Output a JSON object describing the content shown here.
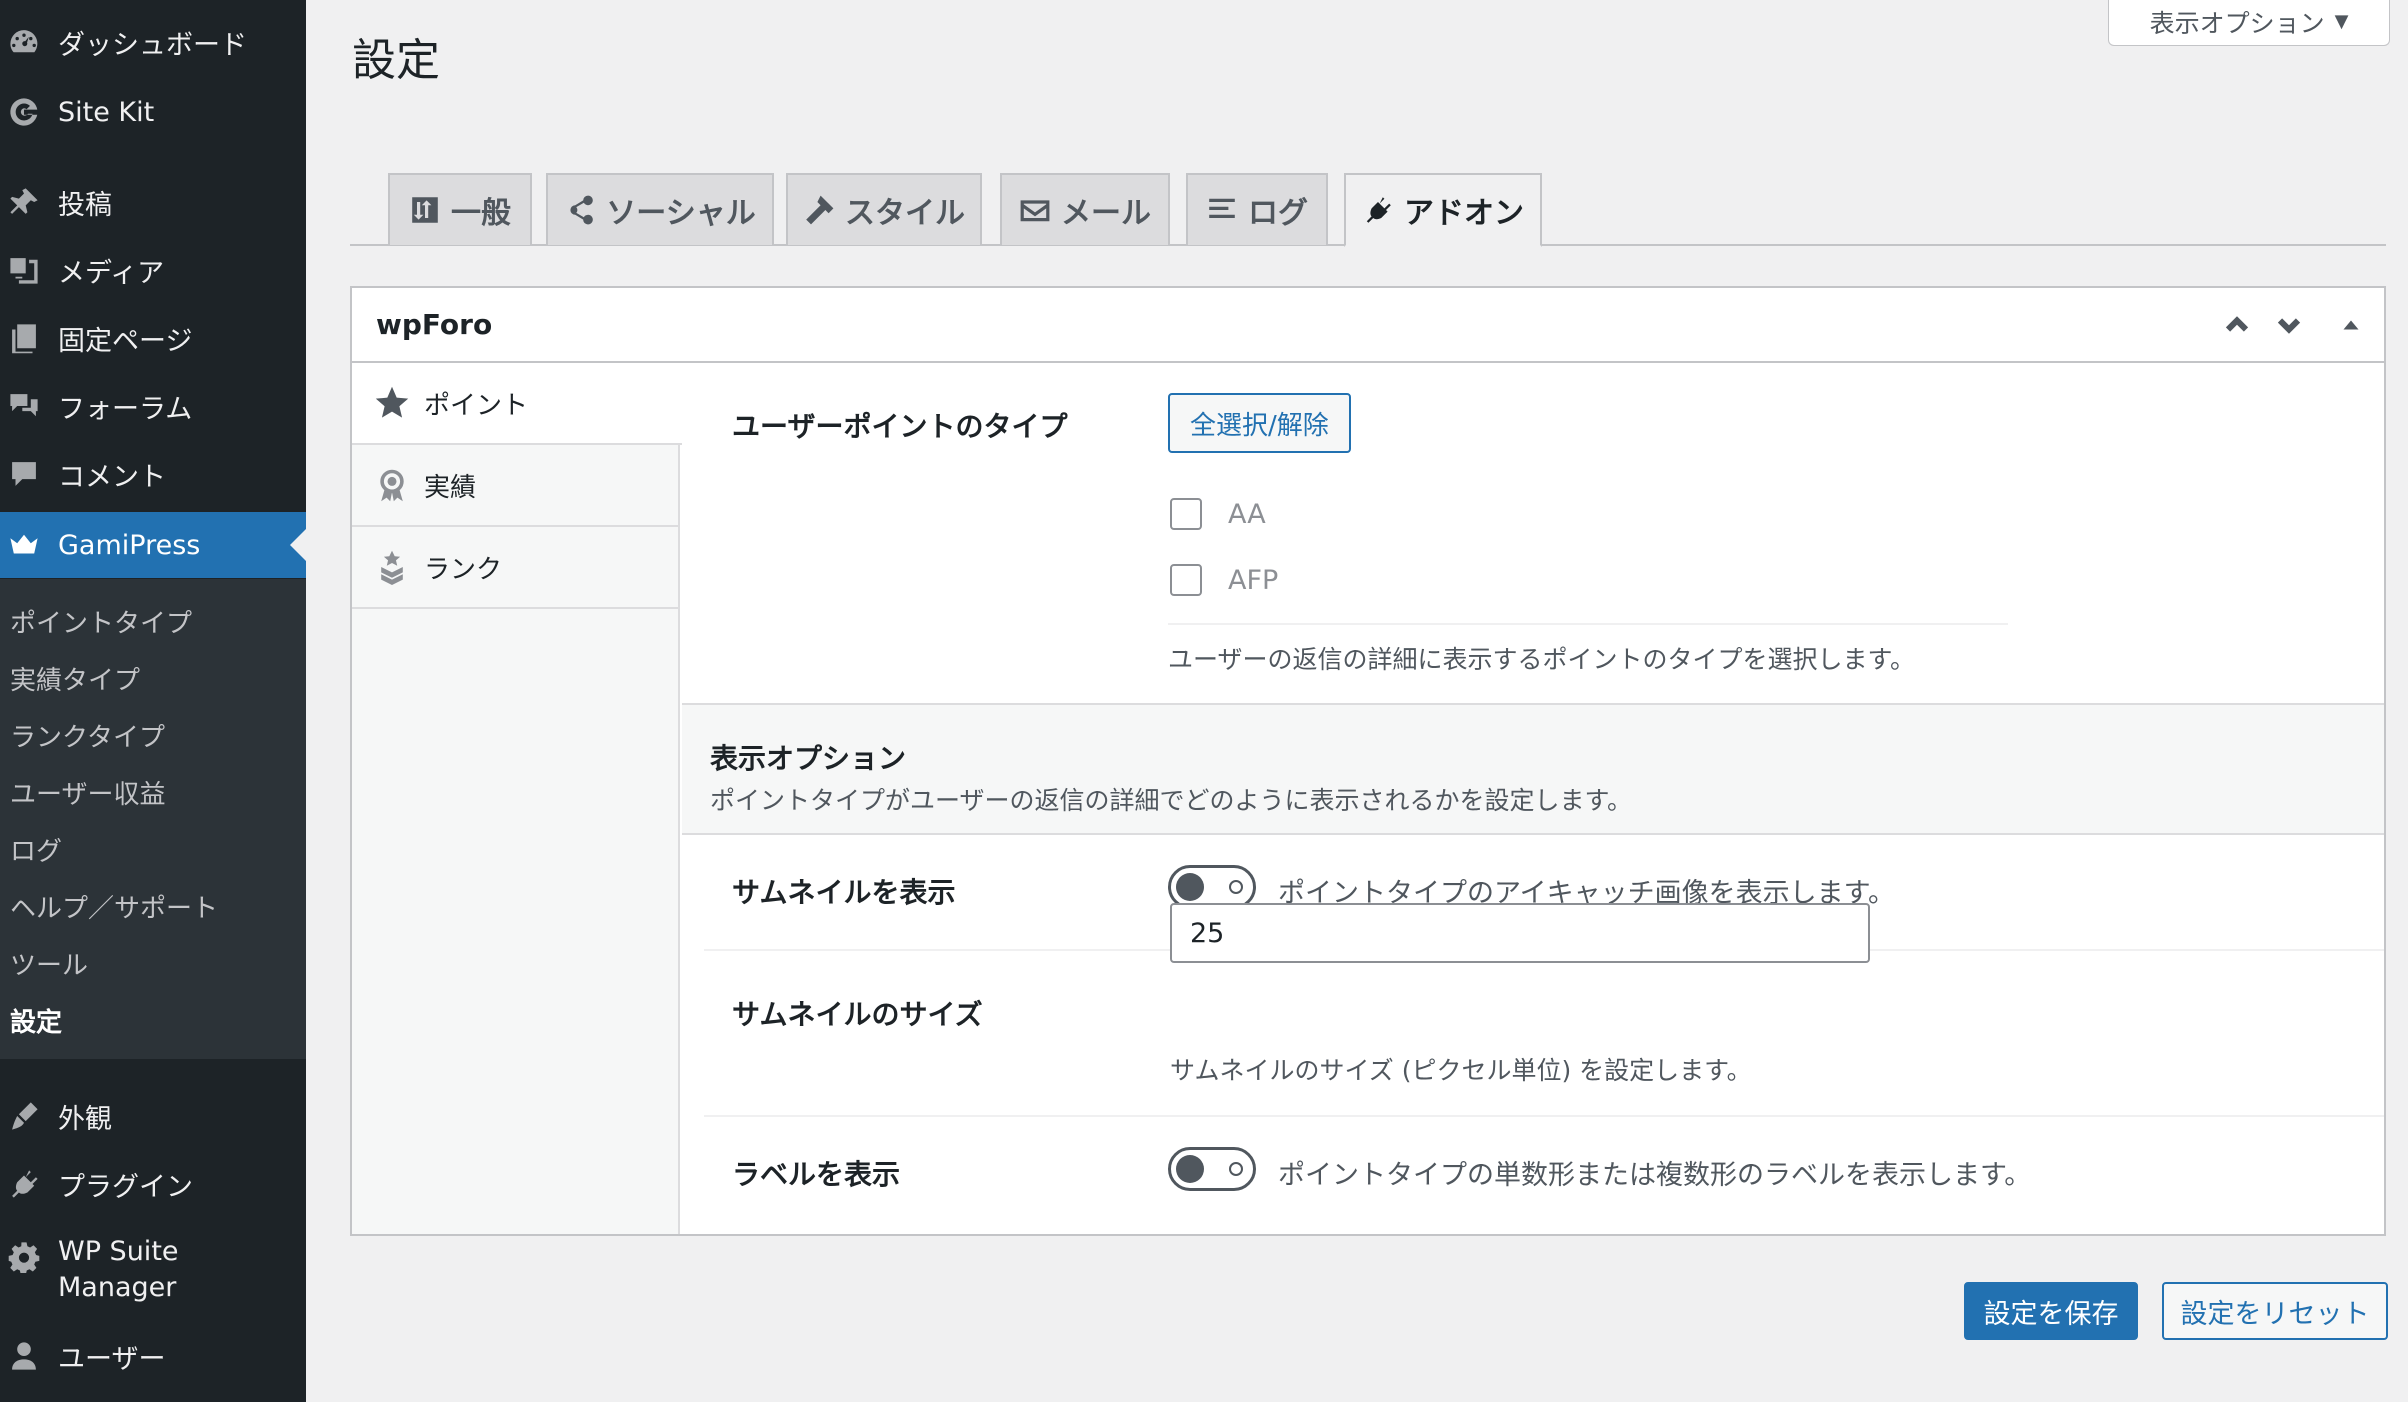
{
  "colors": {
    "sidebar_bg": "#1d2327",
    "submenu_bg": "#2c3338",
    "accent": "#2271b1",
    "page_bg": "#f0f0f1"
  },
  "sidebar": {
    "items": [
      {
        "label": "ダッシュボード",
        "icon": "dashboard-icon"
      },
      {
        "label": "Site Kit",
        "icon": "google-g-icon"
      },
      {
        "label": "投稿",
        "icon": "pin-icon"
      },
      {
        "label": "メディア",
        "icon": "media-icon"
      },
      {
        "label": "固定ページ",
        "icon": "pages-icon"
      },
      {
        "label": "フォーラム",
        "icon": "forum-icon"
      },
      {
        "label": "コメント",
        "icon": "comment-icon"
      },
      {
        "label": "GamiPress",
        "icon": "crown-icon"
      },
      {
        "label": "外観",
        "icon": "brush-icon"
      },
      {
        "label": "プラグイン",
        "icon": "plugin-icon"
      },
      {
        "label": "WP Suite",
        "label2": "Manager",
        "icon": "gear-icon"
      },
      {
        "label": "ユーザー",
        "icon": "user-icon"
      }
    ],
    "submenu": [
      "ポイントタイプ",
      "実績タイプ",
      "ランクタイプ",
      "ユーザー収益",
      "ログ",
      "ヘルプ／サポート",
      "ツール",
      "設定"
    ]
  },
  "header": {
    "title": "設定",
    "screen_options": "表示オプション"
  },
  "tabs": [
    {
      "label": "一般",
      "icon": "sort-icon"
    },
    {
      "label": "ソーシャル",
      "icon": "share-icon"
    },
    {
      "label": "スタイル",
      "icon": "hammer-icon"
    },
    {
      "label": "メール",
      "icon": "email-icon"
    },
    {
      "label": "ログ",
      "icon": "list-icon"
    },
    {
      "label": "アドオン",
      "icon": "plugin-icon"
    }
  ],
  "panel": {
    "title": "wpForo",
    "vtabs": [
      {
        "label": "ポイント",
        "icon": "star-icon"
      },
      {
        "label": "実績",
        "icon": "award-icon"
      },
      {
        "label": "ランク",
        "icon": "rank-icon"
      }
    ],
    "points_type": {
      "label": "ユーザーポイントのタイプ",
      "select_all": "全選択/解除",
      "options": [
        "AA",
        "AFP"
      ],
      "description": "ユーザーの返信の詳細に表示するポイントのタイプを選択します。"
    },
    "display_options": {
      "title": "表示オプション",
      "description": "ポイントタイプがユーザーの返信の詳細でどのように表示されるかを設定します。"
    },
    "thumbnail": {
      "label": "サムネイルを表示",
      "description": "ポイントタイプのアイキャッチ画像を表示します。"
    },
    "thumbnail_size": {
      "label": "サムネイルのサイズ",
      "value": "25",
      "description": "サムネイルのサイズ (ピクセル単位) を設定します。"
    },
    "show_label": {
      "label": "ラベルを表示",
      "description": "ポイントタイプの単数形または複数形のラベルを表示します。"
    }
  },
  "buttons": {
    "save": "設定を保存",
    "reset": "設定をリセット"
  }
}
